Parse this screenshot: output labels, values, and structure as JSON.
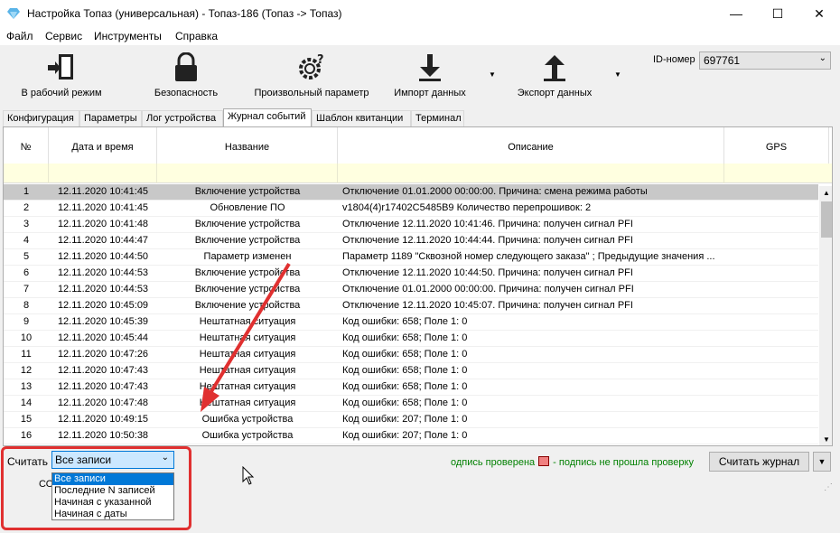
{
  "window": {
    "title": "Настройка Топаз (универсальная) - Топаз-186 (Топаз -> Топаз)",
    "controls": {
      "minimize": "—",
      "maximize": "☐",
      "close": "✕"
    }
  },
  "menu": [
    "Файл",
    "Сервис",
    "Инструменты",
    "Справка"
  ],
  "toolbar": {
    "work_mode": "В рабочий режим",
    "security": "Безопасность",
    "custom_param": "Произвольный параметр",
    "import": "Импорт данных",
    "export": "Экспорт данных",
    "id_label": "ID-номер",
    "id_value": "697761"
  },
  "tabs": [
    "Конфигурация",
    "Параметры",
    "Лог устройства",
    "Журнал событий",
    "Шаблон квитанции",
    "Терминал"
  ],
  "active_tab": 3,
  "table": {
    "headers": [
      "№",
      "Дата и время",
      "Название",
      "Описание",
      "GPS"
    ],
    "rows": [
      {
        "n": "1",
        "date": "12.11.2020 10:41:45",
        "title": "Включение устройства",
        "desc": "Отключение 01.01.2000 00:00:00. Причина: смена режима работы",
        "gps": ""
      },
      {
        "n": "2",
        "date": "12.11.2020 10:41:45",
        "title": "Обновление ПО",
        "desc": "v1804(4)r17402C5485B9 Количество перепрошивок: 2",
        "gps": ""
      },
      {
        "n": "3",
        "date": "12.11.2020 10:41:48",
        "title": "Включение устройства",
        "desc": "Отключение 12.11.2020 10:41:46. Причина: получен сигнал PFI",
        "gps": ""
      },
      {
        "n": "4",
        "date": "12.11.2020 10:44:47",
        "title": "Включение устройства",
        "desc": "Отключение 12.11.2020 10:44:44. Причина: получен сигнал PFI",
        "gps": ""
      },
      {
        "n": "5",
        "date": "12.11.2020 10:44:50",
        "title": "Параметр изменен",
        "desc": "Параметр 1189 \"Сквозной номер следующего заказа\" ; Предыдущие значения ...",
        "gps": ""
      },
      {
        "n": "6",
        "date": "12.11.2020 10:44:53",
        "title": "Включение устройства",
        "desc": "Отключение 12.11.2020 10:44:50. Причина: получен сигнал PFI",
        "gps": ""
      },
      {
        "n": "7",
        "date": "12.11.2020 10:44:53",
        "title": "Включение устройства",
        "desc": "Отключение 01.01.2000 00:00:00. Причина: получен сигнал PFI",
        "gps": ""
      },
      {
        "n": "8",
        "date": "12.11.2020 10:45:09",
        "title": "Включение устройства",
        "desc": "Отключение 12.11.2020 10:45:07. Причина: получен сигнал PFI",
        "gps": ""
      },
      {
        "n": "9",
        "date": "12.11.2020 10:45:39",
        "title": "Нештатная ситуация",
        "desc": "Код ошибки: 658; Поле 1: 0",
        "gps": ""
      },
      {
        "n": "10",
        "date": "12.11.2020 10:45:44",
        "title": "Нештатная ситуация",
        "desc": "Код ошибки: 658; Поле 1: 0",
        "gps": ""
      },
      {
        "n": "11",
        "date": "12.11.2020 10:47:26",
        "title": "Нештатная ситуация",
        "desc": "Код ошибки: 658; Поле 1: 0",
        "gps": ""
      },
      {
        "n": "12",
        "date": "12.11.2020 10:47:43",
        "title": "Нештатная ситуация",
        "desc": "Код ошибки: 658; Поле 1: 0",
        "gps": ""
      },
      {
        "n": "13",
        "date": "12.11.2020 10:47:43",
        "title": "Нештатная ситуация",
        "desc": "Код ошибки: 658; Поле 1: 0",
        "gps": ""
      },
      {
        "n": "14",
        "date": "12.11.2020 10:47:48",
        "title": "Нештатная ситуация",
        "desc": "Код ошибки: 658; Поле 1: 0",
        "gps": ""
      },
      {
        "n": "15",
        "date": "12.11.2020 10:49:15",
        "title": "Ошибка устройства",
        "desc": "Код ошибки: 207; Поле 1: 0",
        "gps": ""
      },
      {
        "n": "16",
        "date": "12.11.2020 10:50:38",
        "title": "Ошибка устройства",
        "desc": "Код ошибки: 207; Поле 1: 0",
        "gps": ""
      }
    ]
  },
  "bottom": {
    "read_label": "Считать",
    "read_value": "Все записи",
    "options": [
      "Все записи",
      "Последние N записей",
      "Начиная с указанной",
      "Начиная с даты"
    ],
    "legend_verified": "одпись проверена",
    "legend_failed": "- подпись не прошла проверку",
    "read_journal": "Считать журнал",
    "status": "СО"
  },
  "colors": {
    "annotation": "#e03030",
    "selected_row": "#c8c8c8",
    "filter_row": "#ffffe0",
    "accent": "#0078d7"
  }
}
